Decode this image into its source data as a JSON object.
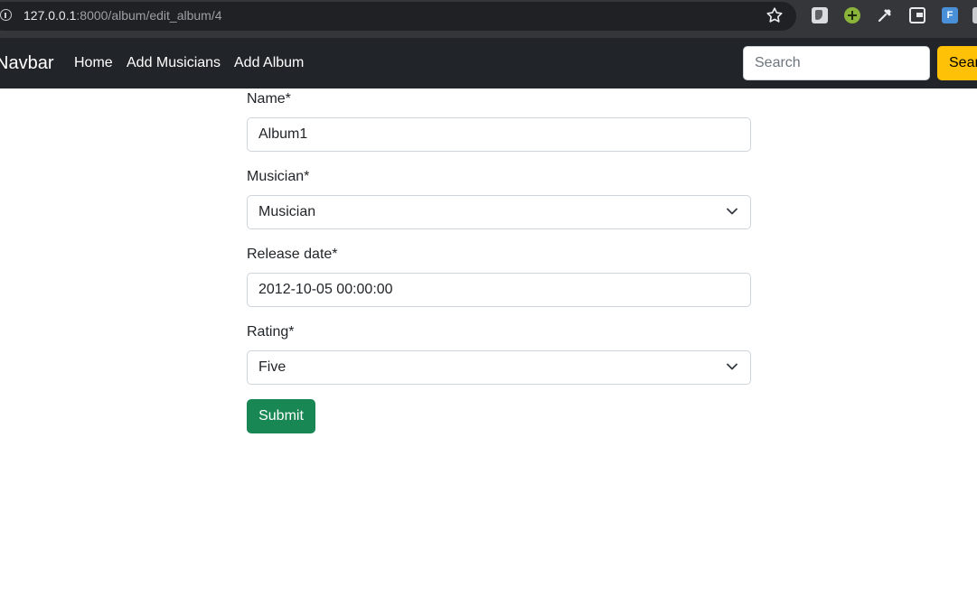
{
  "browser": {
    "url_host": "127.0.0.1",
    "url_path": ":8000/album/edit_album/4"
  },
  "navbar": {
    "brand": "Navbar",
    "links": [
      "Home",
      "Add Musicians",
      "Add Album"
    ],
    "search_placeholder": "Search",
    "search_button": "Search"
  },
  "form": {
    "name_label": "Name*",
    "name_value": "Album1",
    "musician_label": "Musician*",
    "musician_value": "Musician",
    "release_label": "Release date*",
    "release_value": "2012-10-05 00:00:00",
    "rating_label": "Rating*",
    "rating_value": "Five",
    "submit_label": "Submit"
  },
  "colors": {
    "navbar_bg": "#212529",
    "search_button": "#ffc107",
    "submit_button": "#198754"
  }
}
